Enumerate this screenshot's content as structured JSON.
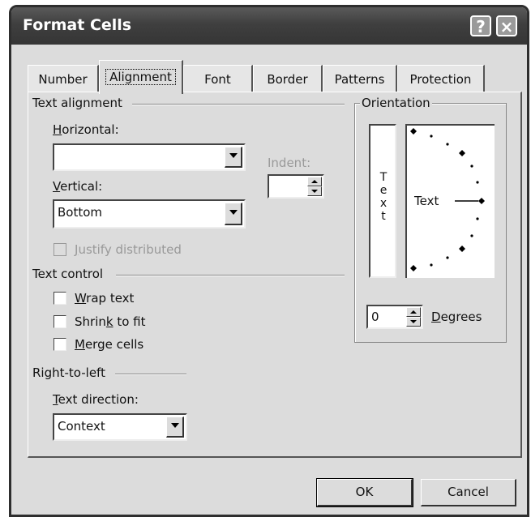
{
  "window": {
    "title": "Format Cells",
    "help_label": "?",
    "close_label": "×"
  },
  "tabs": [
    {
      "label": "Number",
      "active": false
    },
    {
      "label": "Alignment",
      "active": true
    },
    {
      "label": "Font",
      "active": false
    },
    {
      "label": "Border",
      "active": false
    },
    {
      "label": "Patterns",
      "active": false
    },
    {
      "label": "Protection",
      "active": false
    }
  ],
  "text_alignment": {
    "group_label": "Text alignment",
    "horizontal": {
      "key": "H",
      "rest": "orizontal:",
      "value": ""
    },
    "vertical": {
      "key": "V",
      "rest": "ertical:",
      "value": "Bottom"
    },
    "indent": {
      "label": "Indent:",
      "value": ""
    },
    "justify_distributed": {
      "key": "J",
      "rest": "ustify distributed",
      "checked": false,
      "disabled": true
    }
  },
  "orientation": {
    "group_label": "Orientation",
    "vertical_text": [
      "T",
      "e",
      "x",
      "t"
    ],
    "dial_text": "Text",
    "degrees_value": "0",
    "degrees": {
      "key": "D",
      "rest": "egrees"
    }
  },
  "text_control": {
    "group_label": "Text control",
    "wrap": {
      "key": "W",
      "rest": "rap text",
      "checked": false
    },
    "shrink": {
      "pre": "Shrin",
      "key": "k",
      "rest": " to fit",
      "checked": false
    },
    "merge": {
      "key": "M",
      "rest": "erge cells",
      "checked": false
    }
  },
  "rtl": {
    "group_label": "Right-to-left",
    "direction": {
      "key": "T",
      "rest": "ext direction:",
      "value": "Context"
    }
  },
  "buttons": {
    "ok": "OK",
    "cancel": "Cancel"
  }
}
